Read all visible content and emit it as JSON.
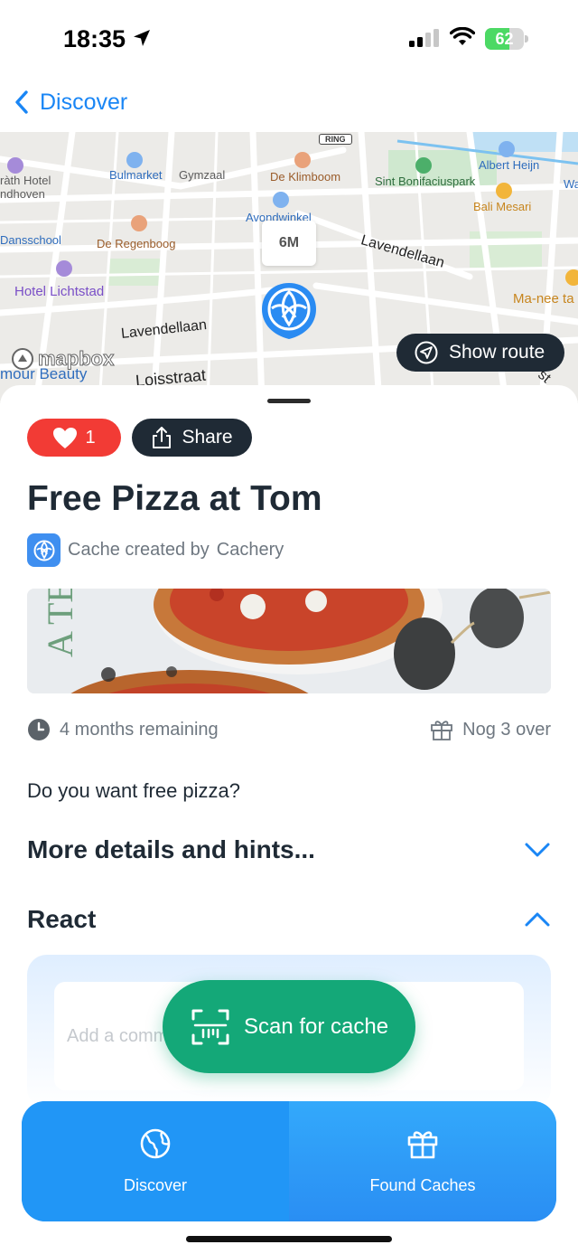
{
  "status_bar": {
    "time": "18:35",
    "battery": "62",
    "battery_fraction": 0.62
  },
  "nav": {
    "back_label": "Discover"
  },
  "map": {
    "ring_sign": "RING",
    "distance": "6M",
    "attribution": "mapbox",
    "show_route_label": "Show route",
    "labels": {
      "hotel_1a": "ràth Hotel",
      "hotel_1b": "ndhoven",
      "bulmarket": "Bulmarket",
      "gymzaal": "Gymzaal",
      "klimboom": "De Klimboom",
      "bonifacius": "Sint Bonifaciuspark",
      "albert": "Albert Heijn",
      "wa": "Wa",
      "avondwinkel": "Avondwinkel",
      "bali": "Bali Mesari",
      "dansschool": "Dansschool",
      "regenboog": "De Regenboog",
      "lavendellaan_1": "Lavendellaan",
      "lichtstad": "Hotel Lichtstad",
      "manee": "Ma-nee ta",
      "lavendellaan_2": "Lavendellaan",
      "beauty": "mour Beauty",
      "straat": "Loisstraat",
      "st": "st"
    }
  },
  "cache": {
    "likes": "1",
    "share_label": "Share",
    "title": "Free Pizza at Tom",
    "created_by_label": "Cache created by",
    "creator": "Cachery",
    "photo_letters": "A TE",
    "remaining": "4 months remaining",
    "stock": "Nog 3 over",
    "question": "Do you want free pizza?"
  },
  "sections": {
    "details": "More details and hints...",
    "react": "React"
  },
  "comment": {
    "placeholder": "Add a comment"
  },
  "scan_button": {
    "label": "Scan for cache"
  },
  "tabs": [
    {
      "label": "Discover",
      "icon": "globe-icon"
    },
    {
      "label": "Found Caches",
      "icon": "gift-icon"
    }
  ],
  "colors": {
    "accent": "#1a86f5",
    "dark": "#1f2a35",
    "like": "#f23b35",
    "scan": "#14a878",
    "tabbar": "#1f90f6"
  }
}
